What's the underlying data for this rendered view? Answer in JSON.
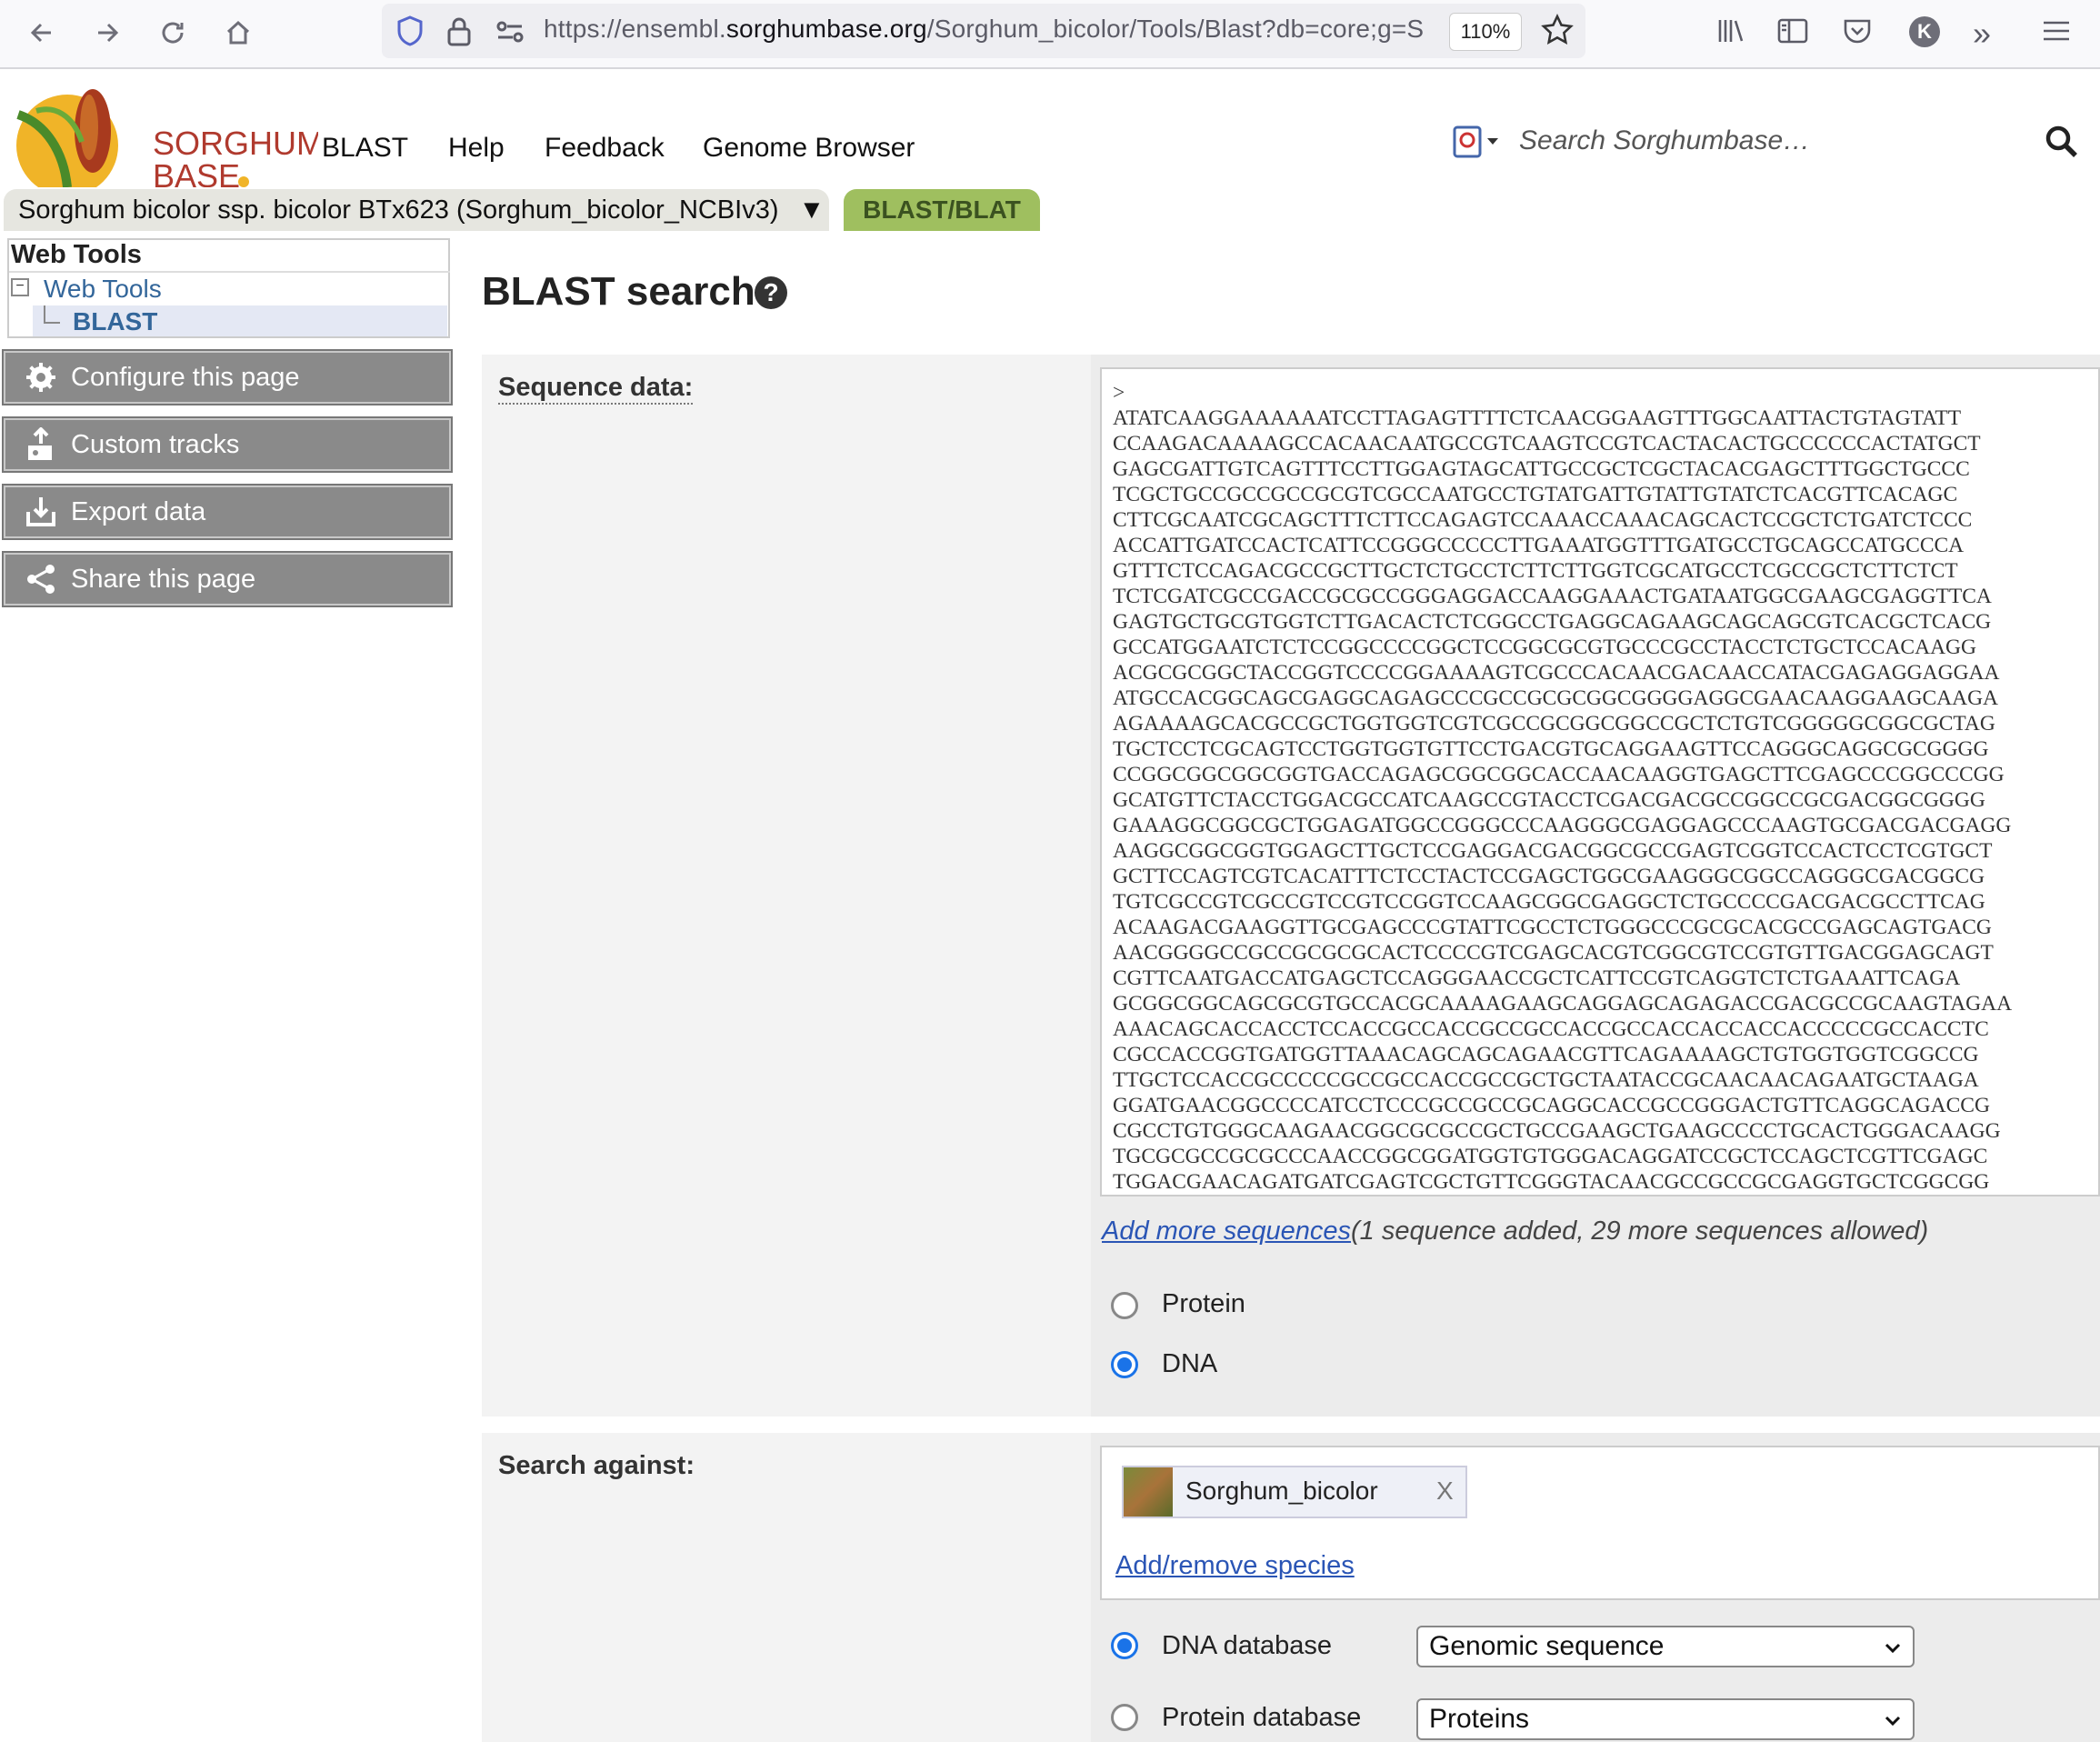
{
  "browser": {
    "url_prefix": "https://ensembl.",
    "url_domain": "sorghumbase.org",
    "url_path": "/Sorghum_bicolor/Tools/Blast?db=core;g=S",
    "zoom": "110%"
  },
  "site": {
    "logo_text_1": "SORGHUM",
    "logo_text_2": "BASE",
    "nav": [
      "BLAST",
      "Help",
      "Feedback",
      "Genome Browser"
    ],
    "search_placeholder": "Search Sorghumbase…"
  },
  "tabs": {
    "species": "Sorghum bicolor ssp. bicolor BTx623 (Sorghum_bicolor_NCBIv3)",
    "species_arrow": "▼",
    "active": "BLAST/BLAT"
  },
  "sidebar": {
    "heading": "Web Tools",
    "tree_parent": "Web Tools",
    "tree_child": "BLAST",
    "buttons": [
      "Configure this page",
      "Custom tracks",
      "Export data",
      "Share this page"
    ]
  },
  "main": {
    "title": "BLAST search",
    "sequence_label": "Sequence data:",
    "sequence": ">\nATATCAAGGAAAAAATCCTTAGAGTTTTCTCAACGGAAGTTTGGCAATTACTGTAGTATT\nCCAAGACAAAAGCCACAACAATGCCGTCAAGTCCGTCACTACACTGCCCCCCACTATGCT\nGAGCGATTGTCAGTTTCCTTGGAGTAGCATTGCCGCTCGCTACACGAGCTTTGGCTGCCC\nTCGCTGCCGCCGCCGCGTCGCCAATGCCTGTATGATTGTATTGTATCTCACGTTCACAGC\nCTTCGCAATCGCAGCTTTCTTCCAGAGTCCAAACCAAACAGCACTCCGCTCTGATCTCCC\nACCATTGATCCACTCATTCCGGGCCCCCTTGAAATGGTTTGATGCCTGCAGCCATGCCCA\nGTTTCTCCAGACGCCGCTTGCTCTGCCTCTTCTTGGTCGCATGCCTCGCCGCTCTTCTCT\nTCTCGATCGCCGACCGCGCCGGGAGGACCAAGGAAACTGATAATGGCGAAGCGAGGTTCA\nGAGTGCTGCGTGGTCTTGACACTCTCGGCCTGAGGCAGAAGCAGCAGCGTCACGCTCACG\nGCCATGGAATCTCTCCGGCCCCGGCTCCGGCGCGTGCCCGCCTACCTCTGCTCCACAAGG\nACGCGCGGCTACCGGTCCCCGGAAAAGTCGCCCACAACGACAACCATACGAGAGGAGGAA\nATGCCACGGCAGCGAGGCAGAGCCCGCCGCGCGGCGGGGAGGCGAACAAGGAAGCAAGA\nAGAAAAGCACGCCGCTGGTGGTCGTCGCCGCGGCGGCCGCTCTGTCGGGGGCGGCGCTAG\nTGCTCCTCGCAGTCCTGGTGGTGTTCCTGACGTGCAGGAAGTTCCAGGGCAGGCGCGGGG\nCCGGCGGCGGCGGTGACCAGAGCGGCGGCACCAACAAGGTGAGCTTCGAGCCCGGCCCGG\nGCATGTTCTACCTGGACGCCATCAAGCCGTACCTCGACGACGCCGGCCGCGACGGCGGGG\nGAAAGGCGGCGCTGGAGATGGCCGGGCCCAAGGGCGAGGAGCCCAAGTGCGACGACGAGG\nAAGGCGGCGGTGGAGCTTGCTCCGAGGACGACGGCGCCGAGTCGGTCCACTCCTCGTGCT\nGCTTCCAGTCGTCACATTTCTCCTACTCCGAGCTGGCGAAGGGCGGCCAGGGCGACGGCG\nTGTCGCCGTCGCCGTCCGTCCGGTCCAAGCGGCGAGGCTCTGCCCCGACGACGCCTTCAG\nACAAGACGAAGGTTGCGAGCCCGTATTCGCCTCTGGGCCCGCGCACGCCGAGCAGTGACG\nAACGGGGCCGCCGCGCGCACTCCCCGTCGAGCACGTCGGCGTCCGTGTTGACGGAGCAGT\nCGTTCAATGACCATGAGCTCCAGGGAACCGCTCATTCCGTCAGGTCTCTGAAATTCAGA\nGCGGCGGCAGCGCGTGCCACGCAAAAGAAGCAGGAGCAGAGACCGACGCCGCAAGTAGAA\nAAACAGCACCACCTCCACCGCCACCGCCGCCACCGCCACCACCACCACCCCCGCCACCTC\nCGCCACCGGTGATGGTTAAACAGCAGCAGAACGTTCAGAAAAGCTGTGGTGGTCGGCCG\nTTGCTCCACCGCCCCCGCCGCCACCGCCGCTGCTAATACCGCAACAACAGAATGCTAAGA\nGGATGAACGGCCCCATCCTCCCGCCGCCGCAGGCACCGCCGGGACTGTTCAGGCAGACCG\nCGCCTGTGGGCAAGAACGGCGCGCCGCTGCCGAAGCTGAAGCCCCTGCACTGGGACAAGG\nTGCGCGCCGCGCCCAACCGGCGGATGGTGTGGGACAGGATCCGCTCCAGCTCGTTCGAGC\nTGGACGAACAGATGATCGAGTCGCTGTTCGGGTACAACGCCGCCGCGAGGTGCTCGGCGG",
    "add_more": "Add more sequences",
    "add_more_note": "(1 sequence added, 29 more sequences allowed)",
    "seq_types": [
      "Protein",
      "DNA"
    ],
    "seq_type_selected": "DNA",
    "search_against_label": "Search against:",
    "species_chip": "Sorghum_bicolor",
    "chip_remove": "X",
    "add_remove_species": "Add/remove species",
    "db_options": [
      {
        "label": "DNA database",
        "value": "Genomic sequence",
        "selected": true
      },
      {
        "label": "Protein database",
        "value": "Proteins",
        "selected": false
      }
    ]
  },
  "icons": [
    "back-icon",
    "forward-icon",
    "reload-icon",
    "home-icon",
    "shield-icon",
    "lock-icon",
    "permissions-icon",
    "star-icon",
    "library-icon",
    "sidebar-icon",
    "pocket-icon",
    "account-icon",
    "overflow-icon",
    "menu-icon",
    "search-icon",
    "gear-icon",
    "upload-icon",
    "download-icon",
    "share-icon",
    "help-icon"
  ],
  "colors": {
    "blast_tab": "#9fbf5f",
    "link": "#2a55b5",
    "tree_link": "#33669a",
    "side_button": "#8a8a8a",
    "radio_on": "#1a73e8"
  }
}
